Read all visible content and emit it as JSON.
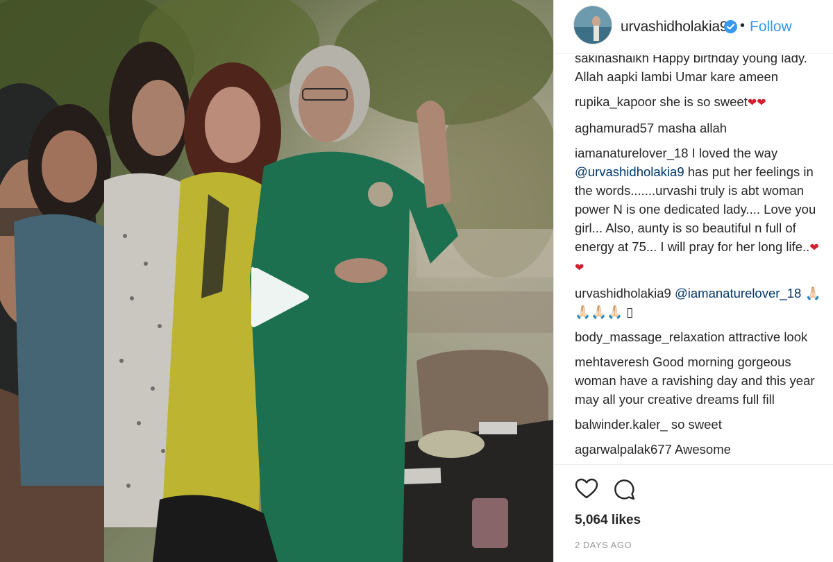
{
  "post": {
    "media_type": "video",
    "play_icon": "play-icon"
  },
  "header": {
    "avatar_icon": "profile-avatar",
    "username": "urvashidholakia9",
    "verified_icon": "verified-badge-icon",
    "separator": "•",
    "follow_label": "Follow",
    "accent_color": "#3897f0"
  },
  "comments": [
    {
      "user": "sakinashaikh",
      "text_line1": "Happy birthday young lady.",
      "text_line2": "Allah aapki lambi Umar kare ameen"
    },
    {
      "user": "rupika_kapoor",
      "text": "she is so sweet",
      "emoji": "❤❤"
    },
    {
      "user": "aghamurad57",
      "text": "masha allah"
    },
    {
      "user": "iamanaturelover_18",
      "text_pre": "I loved the way",
      "mention": "@urvashidholakia9",
      "text_post": "has put her feelings in the words.......urvashi truly is abt woman power N is one dedicated lady.... Love you girl... Also, aunty is so beautiful n full of energy at 75... I will pray for her long life..",
      "emoji": "❤ ❤"
    },
    {
      "user": "urvashidholakia9",
      "mention": "@iamanaturelover_18",
      "emoji": "🙏🏻 🙏🏻🙏🏻🙏🏻 ▯"
    },
    {
      "user": "body_massage_relaxation",
      "text": "attractive look"
    },
    {
      "user": "mehtaveresh",
      "text": "Good morning gorgeous woman have a ravishing day and this year may all your creative dreams full fill"
    },
    {
      "user": "balwinder.kaler_",
      "text": "so sweet"
    },
    {
      "user": "agarwalpalak677",
      "text": "Awesome"
    }
  ],
  "actions": {
    "like_icon": "heart-outline-icon",
    "comment_icon": "comment-bubble-icon"
  },
  "likes_text": "5,064 likes",
  "timestamp": "2 DAYS AGO"
}
